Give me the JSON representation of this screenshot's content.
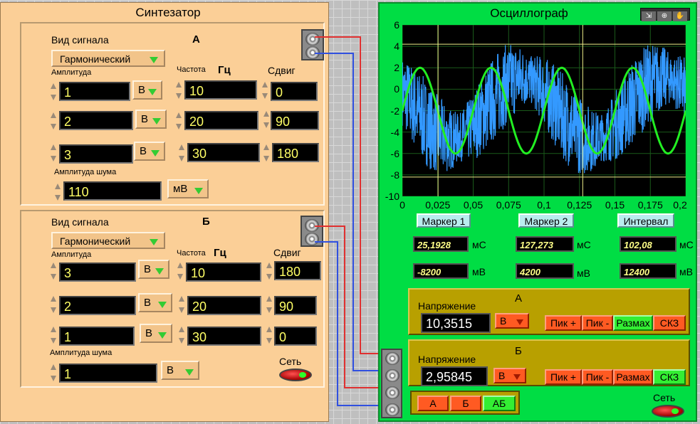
{
  "synth": {
    "title": "Синтезатор",
    "signal_type_label": "Вид сигнала",
    "amplitude_label": "Амплитуда",
    "frequency_label": "Частота",
    "hz_label": "Гц",
    "shift_label": "Сдвиг",
    "shift_label_b": "Сдвиг",
    "noise_label": "Амплитуда шума",
    "power_label": "Сеть",
    "channel_a": {
      "name": "А",
      "waveform": "Гармонический",
      "rows": [
        {
          "amp": "1",
          "unit": "В",
          "freq": "10",
          "shift": "0"
        },
        {
          "amp": "2",
          "unit": "В",
          "freq": "20",
          "shift": "90"
        },
        {
          "amp": "3",
          "unit": "В",
          "freq": "30",
          "shift": "180"
        }
      ],
      "noise": "110",
      "noise_unit": "мВ"
    },
    "channel_b": {
      "name": "Б",
      "waveform": "Гармонический",
      "rows": [
        {
          "amp": "3",
          "unit": "В",
          "freq": "10",
          "shift": "180"
        },
        {
          "amp": "2",
          "unit": "В",
          "freq": "20",
          "shift": "90"
        },
        {
          "amp": "1",
          "unit": "В",
          "freq": "30",
          "shift": "0"
        }
      ],
      "noise": "1",
      "noise_unit": "В"
    }
  },
  "osc": {
    "title": "Осциллограф",
    "toolbar": [
      "zoom-pan-icon",
      "zoom-icon",
      "hand-icon"
    ],
    "markers": {
      "m1_label": "Маркер 1",
      "m2_label": "Маркер 2",
      "interval_label": "Интервал",
      "m1_time": "25,1928",
      "m2_time": "127,273",
      "interval_time": "102,08",
      "time_unit": "мС",
      "m1_volt": "-8200",
      "m2_volt": "4200",
      "interval_volt": "12400",
      "volt_unit": "мВ"
    },
    "voltage_label": "Напряжение",
    "ch_a": {
      "name": "А",
      "value": "10,3515",
      "unit": "В"
    },
    "ch_b": {
      "name": "Б",
      "value": "2,95845",
      "unit": "В"
    },
    "measure_buttons": [
      "Пик +",
      "Пик -",
      "Размах",
      "СКЗ"
    ],
    "source_buttons": [
      "А",
      "Б",
      "АБ"
    ],
    "power_label": "Сеть",
    "colors": {
      "series_a": "#3399ff",
      "series_b": "#22ee22",
      "cursor": "#eeee88"
    }
  },
  "chart_data": {
    "type": "line",
    "xlim": [
      0,
      0.2
    ],
    "ylim": [
      -10,
      6
    ],
    "x_ticks": [
      "0",
      "0,025",
      "0,05",
      "0,075",
      "0,1",
      "0,125",
      "0,15",
      "0,175",
      "0,2"
    ],
    "y_ticks": [
      "6",
      "4",
      "2",
      "0",
      "-2",
      "-4",
      "-6",
      "-8",
      "-10"
    ],
    "grid": true,
    "cursors": {
      "x": [
        0.0252,
        0.1273
      ],
      "y": [
        -8.2,
        4.2
      ]
    }
  }
}
